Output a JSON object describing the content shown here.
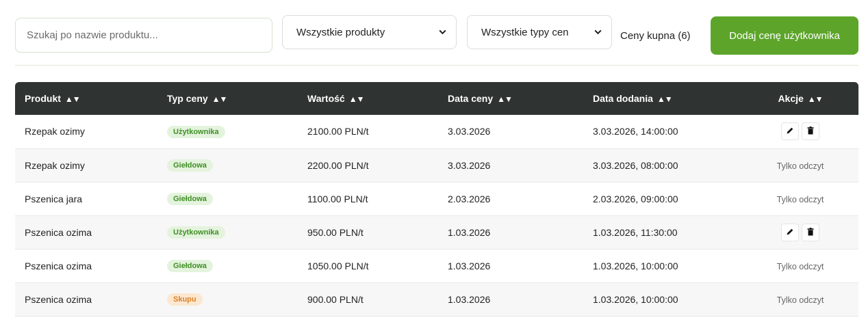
{
  "toolbar": {
    "search_placeholder": "Szukaj po nazwie produktu...",
    "product_filter": "Wszystkie produkty",
    "price_type_filter": "Wszystkie typy cen",
    "count_label": "Ceny kupna (6)",
    "add_button": "Dodaj cenę użytkownika"
  },
  "table": {
    "headers": [
      "Produkt",
      "Typ ceny",
      "Wartość",
      "Data ceny",
      "Data dodania",
      "Akcje"
    ],
    "sort_glyph": "▲▼",
    "readonly_label": "Tylko odczyt",
    "rows": [
      {
        "product": "Rzepak ozimy",
        "type": "Użytkownika",
        "value": "2100.00 PLN/t",
        "price_date": "3.03.2026",
        "added": "3.03.2026, 14:00:00",
        "editable": true
      },
      {
        "product": "Rzepak ozimy",
        "type": "Giełdowa",
        "value": "2200.00 PLN/t",
        "price_date": "3.03.2026",
        "added": "3.03.2026, 08:00:00",
        "editable": false
      },
      {
        "product": "Pszenica jara",
        "type": "Giełdowa",
        "value": "1100.00 PLN/t",
        "price_date": "2.03.2026",
        "added": "2.03.2026, 09:00:00",
        "editable": false
      },
      {
        "product": "Pszenica ozima",
        "type": "Użytkownika",
        "value": "950.00 PLN/t",
        "price_date": "1.03.2026",
        "added": "1.03.2026, 11:30:00",
        "editable": true
      },
      {
        "product": "Pszenica ozima",
        "type": "Giełdowa",
        "value": "1050.00 PLN/t",
        "price_date": "1.03.2026",
        "added": "1.03.2026, 10:00:00",
        "editable": false
      },
      {
        "product": "Pszenica ozima",
        "type": "Skupu",
        "value": "900.00 PLN/t",
        "price_date": "1.03.2026",
        "added": "1.03.2026, 10:00:00",
        "editable": false
      }
    ]
  },
  "colors": {
    "accent_green": "#5da52a",
    "header_dark": "#2f3332",
    "badge_green_bg": "#e4f3dd",
    "badge_orange_bg": "#fde7d0"
  },
  "icons": {
    "chevron": "chevron-down-icon",
    "edit": "pencil-icon",
    "delete": "trash-icon"
  }
}
